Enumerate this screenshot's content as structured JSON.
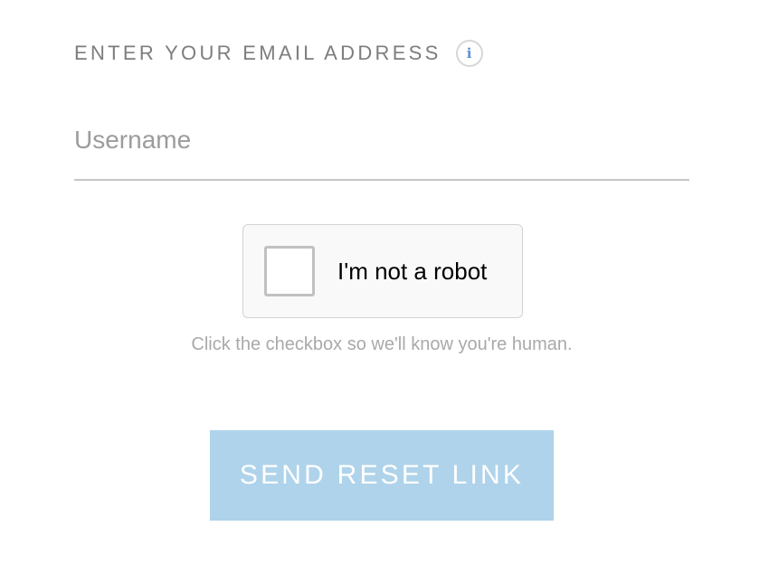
{
  "form": {
    "email_label": "ENTER YOUR EMAIL ADDRESS",
    "info_icon": "info-icon",
    "info_glyph": "i",
    "username_placeholder": "Username",
    "username_value": ""
  },
  "captcha": {
    "checkbox_label": "I'm not a robot",
    "checked": false,
    "hint": "Click the checkbox so we'll know you're human."
  },
  "actions": {
    "send_reset_label": "SEND RESET LINK"
  },
  "colors": {
    "button_background": "#afd3ea",
    "info_icon_accent": "#5b8fd8",
    "label_text": "#7d7d7d",
    "hint_text": "#a9a9a9"
  }
}
